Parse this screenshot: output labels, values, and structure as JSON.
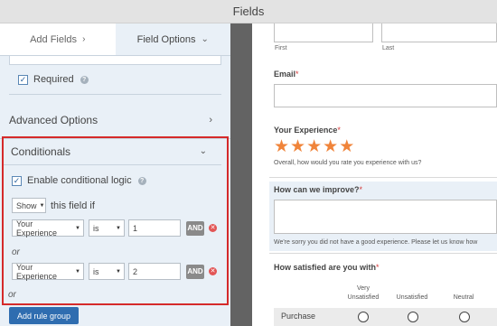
{
  "topbar": {
    "title": "Fields"
  },
  "tabs": {
    "add_fields": "Add Fields",
    "add_fields_chevron": "›",
    "field_options": "Field Options",
    "field_options_chevron": "⌄"
  },
  "required": {
    "label": "Required",
    "checked": true
  },
  "advanced": {
    "label": "Advanced Options",
    "chevron": "›"
  },
  "conditionals": {
    "label": "Conditionals",
    "chevron": "⌄",
    "enable_label": "Enable conditional logic",
    "action": "Show",
    "field_if": "this field if",
    "rules": [
      {
        "field": "Your Experience",
        "operator": "is",
        "value": "1",
        "and_label": "AND",
        "connector_before": ""
      },
      {
        "field": "Your Experience",
        "operator": "is",
        "value": "2",
        "and_label": "AND",
        "connector_before": "or"
      }
    ],
    "or_label": "or",
    "or_after": "or",
    "add_rule_group": "Add rule group"
  },
  "form": {
    "first_label": "First",
    "last_label": "Last",
    "email_label": "Email",
    "experience_label": "Your Experience",
    "experience_desc": "Overall, how would you rate you experience with us?",
    "rating": 5,
    "improve_label": "How can we improve?",
    "improve_desc": "We're sorry you did not have a good experience. Please let us know how",
    "satisfied_label": "How satisfied are you with",
    "likert_columns": [
      "Very\nUnsatisfied",
      "Unsatisfied",
      "Neutral"
    ],
    "likert_row": "Purchase",
    "required_mark": "*"
  },
  "colors": {
    "accent": "#2f6db0",
    "highlight_border": "#d52a2a",
    "star": "#f0843a",
    "panel_bg": "#e9f0f7"
  }
}
